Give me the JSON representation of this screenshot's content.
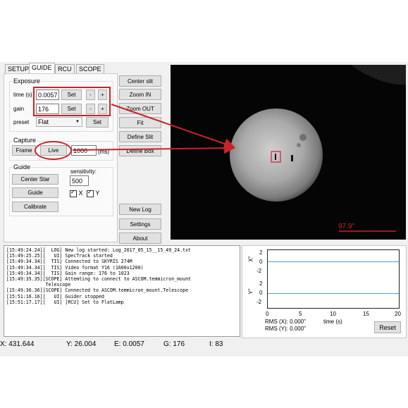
{
  "tabs": [
    {
      "label": "SETUP",
      "active": false
    },
    {
      "label": "GUIDE",
      "active": true
    },
    {
      "label": "RCU",
      "active": false
    },
    {
      "label": "SCOPE",
      "active": false
    }
  ],
  "exposure": {
    "title": "Exposure",
    "time_label": "time (s)",
    "time_value": "0.0057",
    "gain_label": "gain",
    "gain_value": "176",
    "set_label": "Set",
    "minus": "-",
    "plus": "+",
    "preset_label": "preset",
    "preset_value": "Flat",
    "preset_set": "Set"
  },
  "capture": {
    "title": "Capture",
    "frame": "Frame",
    "live": "Live",
    "ms_value": "1000",
    "ms_unit": "(ms)"
  },
  "guide": {
    "title": "Guide",
    "center_star": "Center Star",
    "guide": "Guide",
    "calibrate": "Calibrate",
    "sensitivity_label": "sensitivity:",
    "sensitivity_value": "500",
    "x_label": "X",
    "y_label": "Y"
  },
  "side_buttons": {
    "center_slit": "Center slit",
    "zoom_in": "Zoom IN",
    "zoom_out": "Zoom OUT",
    "fit": "Fit",
    "define_slit": "Define Slit",
    "define_box": "Define Box",
    "new_log": "New Log",
    "settings": "Settings",
    "about": "About"
  },
  "image": {
    "scale_label": "97.9\""
  },
  "log": [
    "[15:49:24.24][  LOG] New log started: Log_2017_05_15__15_49_24.txt",
    "[15:49:25.25][   UI] SpecTrack started",
    "[15:49:34.34][  TIS] Connected to SKYRIS 274M",
    "[15:49:34.34][  TIS] Video format Y16 (1600x1200)",
    "[15:49:34.34][  TIS] Gain range: 176 to 1023",
    "[15:49:35.35][SCOPE] Attemting to connect to ASCOM.temmicron_mount",
    "              Telescope",
    "[15:49:36.36][SCOPE] Connected to ASCOM.temmicron_mount.Telescope",
    "[15:51:16.16][   UI] Guider stopped",
    "[15:51:17.17][   UI] [RCU] Set to FlatLamp"
  ],
  "graph": {
    "x_axis_label": "X\"",
    "y_axis_label": "Y\"",
    "top_ticks": [
      "2",
      "0",
      "-2"
    ],
    "bottom_ticks": [
      "2",
      "0",
      "-2"
    ],
    "x_ticks": [
      "0",
      "5",
      "10",
      "15",
      "20"
    ],
    "x_title": "time (s)",
    "rms_x": "RMS (X): 0.000\"",
    "rms_y": "RMS (Y): 0.000\"",
    "reset": "Reset",
    "line_color": "#4aa3c6"
  },
  "status": {
    "x": "X:  431.644",
    "y": "Y:  26.004",
    "e": "E:  0.0057",
    "g": "G:  176",
    "i": "I:  83"
  },
  "colors": {
    "highlight": "#c8232c"
  }
}
